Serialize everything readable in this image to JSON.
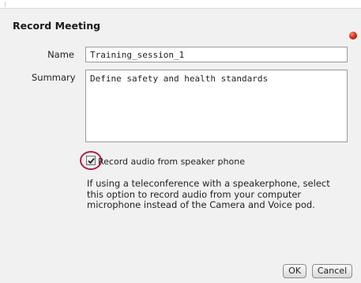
{
  "dialog": {
    "title": "Record Meeting",
    "close_icon": "close-icon",
    "close_color": "#d8321d"
  },
  "form": {
    "name_label": "Name",
    "name_value": "Training_session_1",
    "summary_label": "Summary",
    "summary_value": "Define safety and health standards"
  },
  "speaker_phone": {
    "checked": true,
    "label": "Record audio from speaker phone",
    "help_lines": [
      "If using a teleconference with a speakerphone, select",
      "this option to record audio from your computer",
      "microphone instead of the Camera and Voice pod."
    ],
    "highlight_color": "#b0224a"
  },
  "buttons": {
    "ok_label": "OK",
    "cancel_label": "Cancel"
  }
}
